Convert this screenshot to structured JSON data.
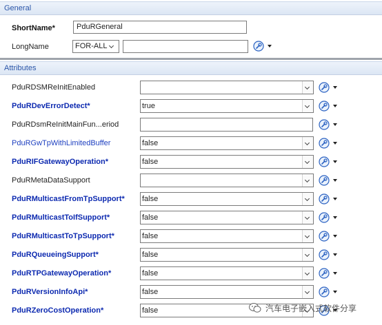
{
  "sections": {
    "general": "General",
    "attributes": "Attributes"
  },
  "general": {
    "shortname_label": "ShortName*",
    "shortname_value": "PduRGeneral",
    "longname_label": "LongName",
    "longname_lang": "FOR-ALL",
    "longname_value": ""
  },
  "attributes": [
    {
      "label": "PduRDSMReInitEnabled",
      "value": "",
      "style": "normal",
      "has_dropdown": true
    },
    {
      "label": "PduRDevErrorDetect*",
      "value": "true",
      "style": "req",
      "has_dropdown": true
    },
    {
      "label": "PduRDsmReInitMainFun...eriod",
      "value": "",
      "style": "normal",
      "has_dropdown": false
    },
    {
      "label": "PduRGwTpWithLimitedBuffer",
      "value": "false",
      "style": "blue",
      "has_dropdown": true
    },
    {
      "label": "PduRIFGatewayOperation*",
      "value": "false",
      "style": "req",
      "has_dropdown": true
    },
    {
      "label": "PduRMetaDataSupport",
      "value": "",
      "style": "normal",
      "has_dropdown": true
    },
    {
      "label": "PduRMulticastFromTpSupport*",
      "value": "false",
      "style": "req",
      "has_dropdown": true
    },
    {
      "label": "PduRMulticastToIfSupport*",
      "value": "false",
      "style": "req",
      "has_dropdown": true
    },
    {
      "label": "PduRMulticastToTpSupport*",
      "value": "false",
      "style": "req",
      "has_dropdown": true
    },
    {
      "label": "PduRQueueingSupport*",
      "value": "false",
      "style": "req",
      "has_dropdown": true
    },
    {
      "label": "PduRTPGatewayOperation*",
      "value": "false",
      "style": "req",
      "has_dropdown": true
    },
    {
      "label": "PduRVersionInfoApi*",
      "value": "false",
      "style": "req",
      "has_dropdown": true
    },
    {
      "label": "PduRZeroCostOperation*",
      "value": "false",
      "style": "req",
      "has_dropdown": true
    }
  ],
  "watermark": "汽车电子嵌入式软件分享",
  "icons": {
    "tool": "wrench-blue-circle-icon",
    "menu": "caret-down-icon"
  },
  "colors": {
    "required_label": "#0d2ab0",
    "section_text": "#2a55a8",
    "section_bg": "#dce6f4"
  }
}
